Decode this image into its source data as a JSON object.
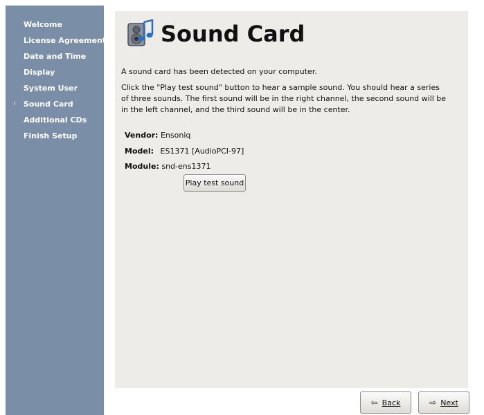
{
  "sidebar": {
    "items": [
      {
        "label": "Welcome"
      },
      {
        "label": "License Agreement"
      },
      {
        "label": "Date and Time"
      },
      {
        "label": "Display"
      },
      {
        "label": "System User"
      },
      {
        "label": "Sound Card",
        "current": true
      },
      {
        "label": "Additional CDs"
      },
      {
        "label": "Finish Setup"
      }
    ],
    "current_marker": "›"
  },
  "page": {
    "title": "Sound Card",
    "title_icon": "speaker-music-icon",
    "detected_text": "A sound card has been detected on your computer.",
    "instruction_lines": [
      "Click the \"Play test sound\" button to hear a sample sound.  You should hear a series",
      "of three sounds.  The first sound will be in the right channel, the second sound will be",
      "in the left channel, and the third sound will be in the center."
    ],
    "vendor_label": "Vendor:",
    "vendor_value": "Ensoniq",
    "model_label": "Model:",
    "model_value": "ES1371 [AudioPCI-97]",
    "module_label": "Module:",
    "module_value": "snd-ens1371",
    "play_button_label": "Play test sound"
  },
  "buttons": {
    "back_label": "Back",
    "next_label": "Next",
    "back_icon": "arrow-left-icon",
    "next_icon": "arrow-right-icon"
  },
  "colors": {
    "sidebar_bg": "#7a8fa7",
    "panel_bg": "#eeece8"
  }
}
